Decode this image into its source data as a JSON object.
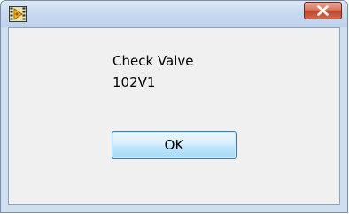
{
  "dialog": {
    "title": "",
    "icon": "labview-vi-icon",
    "close_icon": "close-icon",
    "message_lines": [
      "Check Valve",
      "102V1"
    ],
    "ok_label": "OK"
  },
  "colors": {
    "frame": "#cfdff0",
    "client_bg": "#f0f0f0",
    "close_red": "#c2452c",
    "button_blue": "#bee6fd"
  }
}
